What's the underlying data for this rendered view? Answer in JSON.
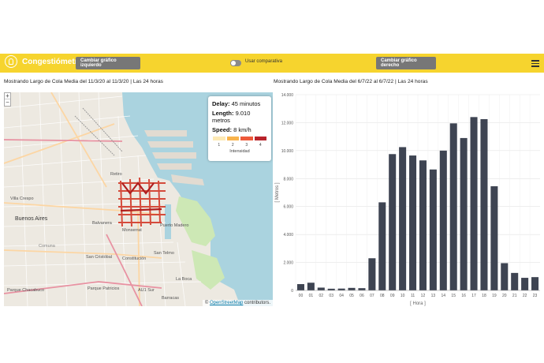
{
  "navbar": {
    "brand": "Congestiómetro",
    "left_button": "Cambiar gráfico izquierdo",
    "toggle_label": "Usar comparativa",
    "right_button": "Cambiar gráfico derecho"
  },
  "left_panel": {
    "caption": "Mostrando Largo de Cola Media del 11/3/20 al 11/3/20 | Las 24 horas",
    "zoom_in": "+",
    "zoom_out": "−",
    "map_labels": [
      "Retiro",
      "Villa Crespo",
      "Buenos Aires",
      "Balvanera",
      "Comuna",
      "Monserrat",
      "Puerto Madero",
      "San Cristóbal",
      "Constitución",
      "San Telmo",
      "Parque Chacabuco",
      "Parque Patricios",
      "La Boca",
      "Barracas",
      "AU1 Sur"
    ],
    "legend": {
      "delay_label": "Delay:",
      "delay_value": "45 minutos",
      "length_label": "Length:",
      "length_value": "9.010 metros",
      "speed_label": "Speed:",
      "speed_value": "8 km/h",
      "scale_labels": [
        "1",
        "2",
        "3",
        "4"
      ],
      "scale_colors": [
        "#fde9b4",
        "#f8b34c",
        "#ee5a3a",
        "#b8242b"
      ],
      "title": "Intensidad"
    },
    "attribution_prefix": "©",
    "attribution_link": "OpenStreetMap",
    "attribution_suffix": "contributors."
  },
  "right_panel": {
    "caption": "Mostrando Largo de Cola Media del 6/7/22 al 6/7/22 | Las 24 horas"
  },
  "chart_data": {
    "type": "bar",
    "categories": [
      "00",
      "01",
      "02",
      "03",
      "04",
      "05",
      "06",
      "07",
      "08",
      "09",
      "10",
      "11",
      "12",
      "13",
      "14",
      "15",
      "16",
      "17",
      "18",
      "19",
      "20",
      "21",
      "22",
      "23"
    ],
    "values": [
      450,
      550,
      200,
      120,
      130,
      180,
      160,
      2300,
      6300,
      9750,
      10250,
      9650,
      9300,
      8650,
      10000,
      11950,
      10900,
      12400,
      12250,
      7450,
      1950,
      1250,
      900,
      950
    ],
    "ylim": [
      0,
      14000
    ],
    "yticks": [
      0,
      2000,
      4000,
      6000,
      8000,
      10000,
      12000,
      14000
    ],
    "ytick_labels": [
      "0",
      "2.000",
      "4.000",
      "6.000",
      "8.000",
      "10.000",
      "12.000",
      "14.000"
    ],
    "xlabel": "[ Hora ]",
    "ylabel": "[ Metros ]",
    "bar_color": "#3e4452",
    "grid": true
  }
}
